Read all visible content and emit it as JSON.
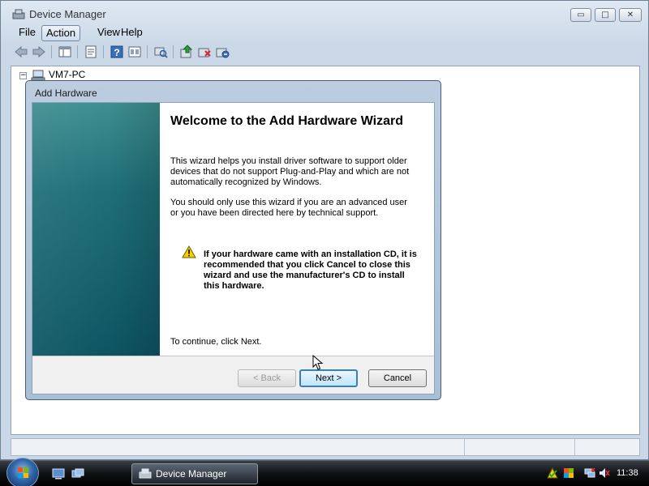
{
  "window": {
    "title": "Device Manager",
    "caption_buttons": {
      "minimize": "▭",
      "maximize": "□",
      "close": "✕"
    }
  },
  "menubar": {
    "items": [
      "File",
      "Action",
      "View",
      "Help"
    ]
  },
  "toolbar": {
    "icons": [
      "back-icon",
      "forward-icon",
      "console-tree-icon",
      "properties-icon",
      "help-icon",
      "view-icon",
      "scan-hardware-icon",
      "update-driver-icon",
      "uninstall-icon",
      "disable-icon"
    ]
  },
  "tree": {
    "root_label": "VM7-PC",
    "expander": "−"
  },
  "wizard": {
    "title": "Add Hardware",
    "heading": "Welcome to the Add Hardware Wizard",
    "paragraph1": "This wizard helps you install driver software to support older devices that do not support Plug-and-Play and which are not automatically recognized by Windows.",
    "paragraph2": "You should only use this wizard if you are an advanced user or you have been directed here by technical support.",
    "warning": "If your hardware came with an installation CD, it is recommended that you click Cancel to close this wizard and use the manufacturer's CD to install this hardware.",
    "continue_text": "To continue, click Next.",
    "buttons": {
      "back": "< Back",
      "next": "Next >",
      "cancel": "Cancel"
    }
  },
  "taskbar": {
    "task_label": "Device Manager",
    "clock": "11:38"
  },
  "colors": {
    "wizard_banner": "#1f6f78",
    "next_button_border": "#3c7fb1",
    "warning_yellow": "#f4d000"
  }
}
